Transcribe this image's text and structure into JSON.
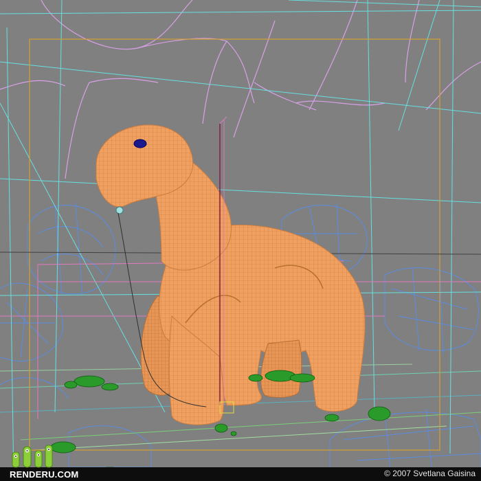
{
  "viewport": {
    "background": "#808080",
    "colors": {
      "model_fill": "#f0a060",
      "model_wire": "#d98a4c",
      "eye": "#1a1a8c",
      "splines": "#d9a0e6",
      "camera_guides": "#66e0e0",
      "safe_frame": "#d4a030",
      "rocks_wire": "#5a8ce0",
      "grass_wire": "#2a9a2a",
      "horizon": "#404040"
    }
  },
  "watermark": {
    "logo_text": "RENDERU.COM",
    "copyright": "© 2007 Svetlana Gaisina"
  }
}
